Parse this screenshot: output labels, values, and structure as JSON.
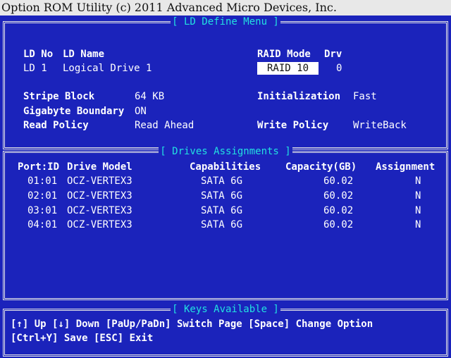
{
  "window": {
    "title": "Option ROM Utility (c) 2011 Advanced Micro Devices, Inc."
  },
  "ld_define": {
    "title": "[ LD Define Menu ]",
    "ld_no_label": "LD No",
    "ld_name_label": "LD Name",
    "raid_mode_label": "RAID Mode",
    "drv_label": "Drv",
    "ld_no_value": "LD  1",
    "ld_name_value": "Logical Drive 1",
    "raid_mode_value": "RAID 10",
    "drv_value": "0",
    "stripe_block_label": "Stripe Block",
    "stripe_block_value": "64  KB",
    "gigabyte_boundary_label": "Gigabyte Boundary",
    "gigabyte_boundary_value": "ON",
    "read_policy_label": "Read Policy",
    "read_policy_value": "Read Ahead",
    "initialization_label": "Initialization",
    "initialization_value": "Fast",
    "write_policy_label": "Write Policy",
    "write_policy_value": "WriteBack"
  },
  "drives": {
    "title": "[ Drives Assignments ]",
    "headers": [
      "Port:ID",
      "Drive Model",
      "Capabilities",
      "Capacity(GB)",
      "Assignment"
    ],
    "rows": [
      {
        "port": "01:01",
        "model": "OCZ-VERTEX3",
        "cap": "SATA 6G",
        "capacity": "60.02",
        "assign": "N"
      },
      {
        "port": "02:01",
        "model": "OCZ-VERTEX3",
        "cap": "SATA 6G",
        "capacity": "60.02",
        "assign": "N"
      },
      {
        "port": "03:01",
        "model": "OCZ-VERTEX3",
        "cap": "SATA 6G",
        "capacity": "60.02",
        "assign": "N"
      },
      {
        "port": "04:01",
        "model": "OCZ-VERTEX3",
        "cap": "SATA 6G",
        "capacity": "60.02",
        "assign": "N"
      }
    ]
  },
  "keys": {
    "title": "[ Keys Available ]",
    "line1": "[↑] Up  [↓] Down  [PaUp/PaDn] Switch Page  [Space] Change Option",
    "line2": "[Ctrl+Y] Save  [ESC] Exit"
  },
  "colors": {
    "background": "#1b23bb",
    "panel_title": "#22e0e0",
    "text": "#ffffff",
    "highlight_bg": "#ffffff"
  }
}
